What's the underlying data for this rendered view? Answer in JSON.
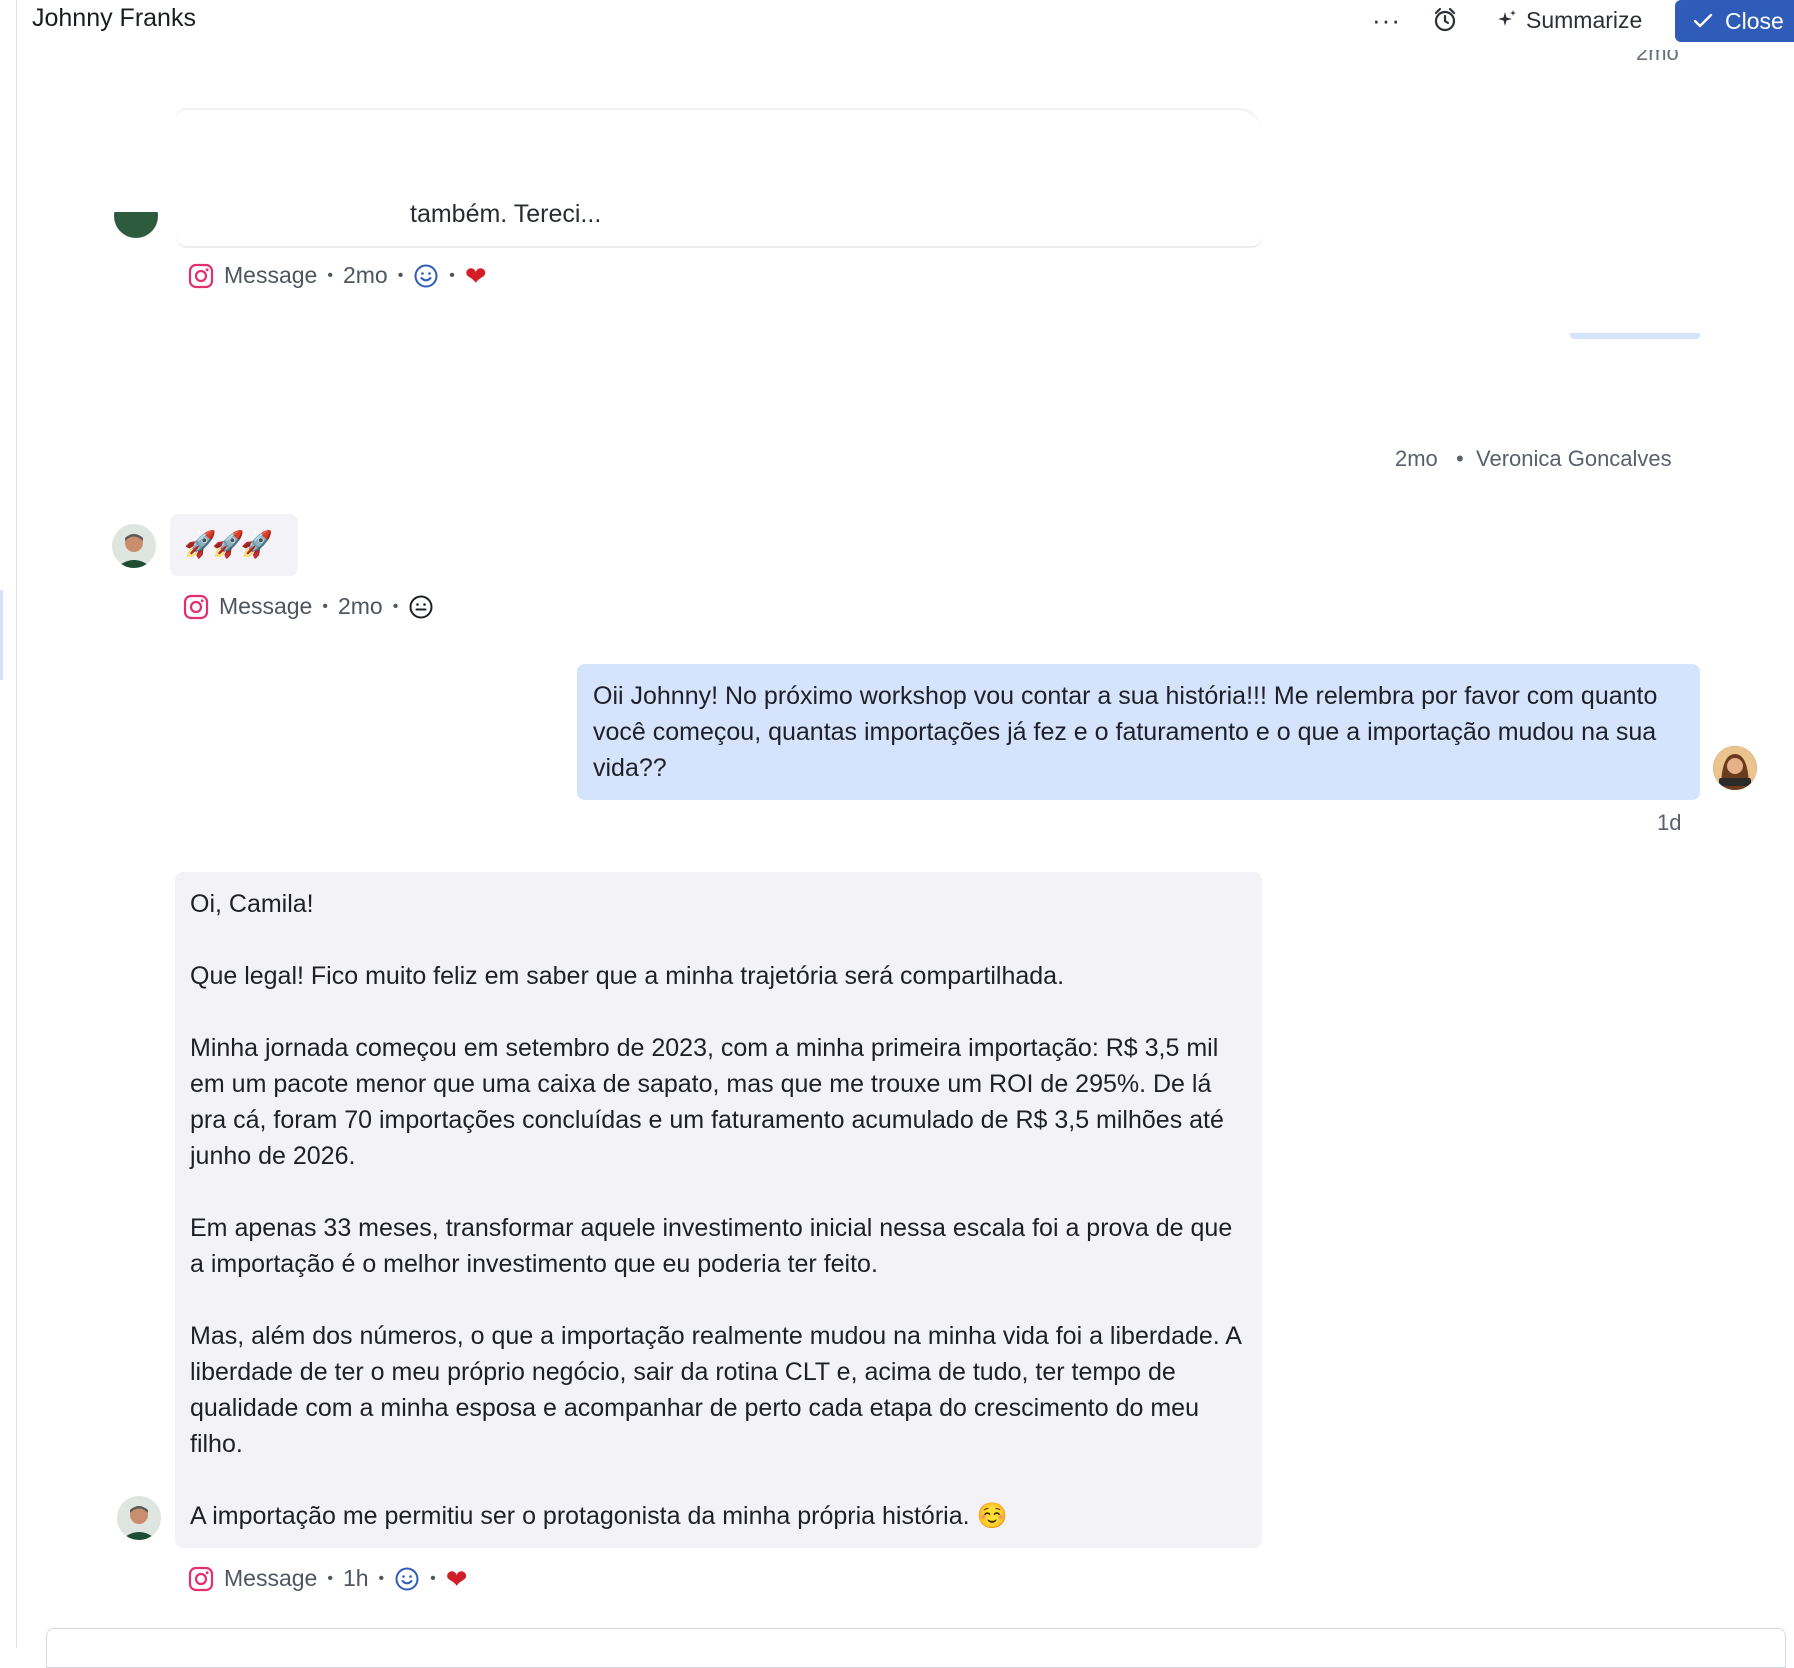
{
  "header": {
    "title": "Johnny Franks",
    "more_label": "···",
    "summarize_label": "Summarize",
    "close_label": "Close"
  },
  "top_partial_time": "2mo",
  "faded_message": {
    "partial_text": "também. Tereci..."
  },
  "msg1_meta": {
    "channel": "Message",
    "time": "2mo"
  },
  "sender_row": {
    "time": "2mo",
    "author": "Veronica Goncalves"
  },
  "msg2": {
    "text": "🚀🚀🚀",
    "channel": "Message",
    "time": "2mo"
  },
  "msg3": {
    "text": "Oii Johnny! No próximo workshop vou contar a sua história!!! Me relembra por favor com quanto você começou, quantas importações já fez e o faturamento e o que a importação mudou na sua vida??",
    "time": "1d"
  },
  "msg4": {
    "paragraphs": [
      "Oi, Camila!",
      "Que legal! Fico muito feliz em saber que a minha trajetória será compartilhada.",
      "Minha jornada começou em setembro de 2023, com a minha primeira importação: R$ 3,5 mil em um pacote menor que uma caixa de sapato, mas que me trouxe um ROI de 295%. De lá pra cá, foram 70 importações concluídas e um faturamento acumulado de R$ 3,5 milhões até junho de 2026.",
      "Em apenas 33 meses, transformar aquele investimento inicial nessa escala foi a prova de que a importação é o melhor investimento que eu poderia ter feito.",
      "Mas, além dos números, o que a importação realmente mudou na minha vida foi a liberdade. A liberdade de ter o meu próprio negócio, sair da rotina CLT e, acima de tudo, ter tempo de qualidade com a minha esposa e acompanhar de perto cada etapa do crescimento do meu filho.",
      "A importação me permitiu ser o protagonista da minha própria história. ☺️"
    ],
    "channel": "Message",
    "time": "1h"
  },
  "icons": {
    "alarm": "alarm-clock-icon",
    "sparkle": "sparkle-icon",
    "check": "check-icon",
    "instagram": "instagram-icon",
    "smile": "smiley-icon",
    "heart": "heart-icon"
  },
  "colors": {
    "accent": "#2f5cb8",
    "outgoing_bubble": "#d5e3fc",
    "incoming_bubble": "#f3f2f7",
    "instagram": "#e1306c",
    "heart": "#d21f27"
  }
}
